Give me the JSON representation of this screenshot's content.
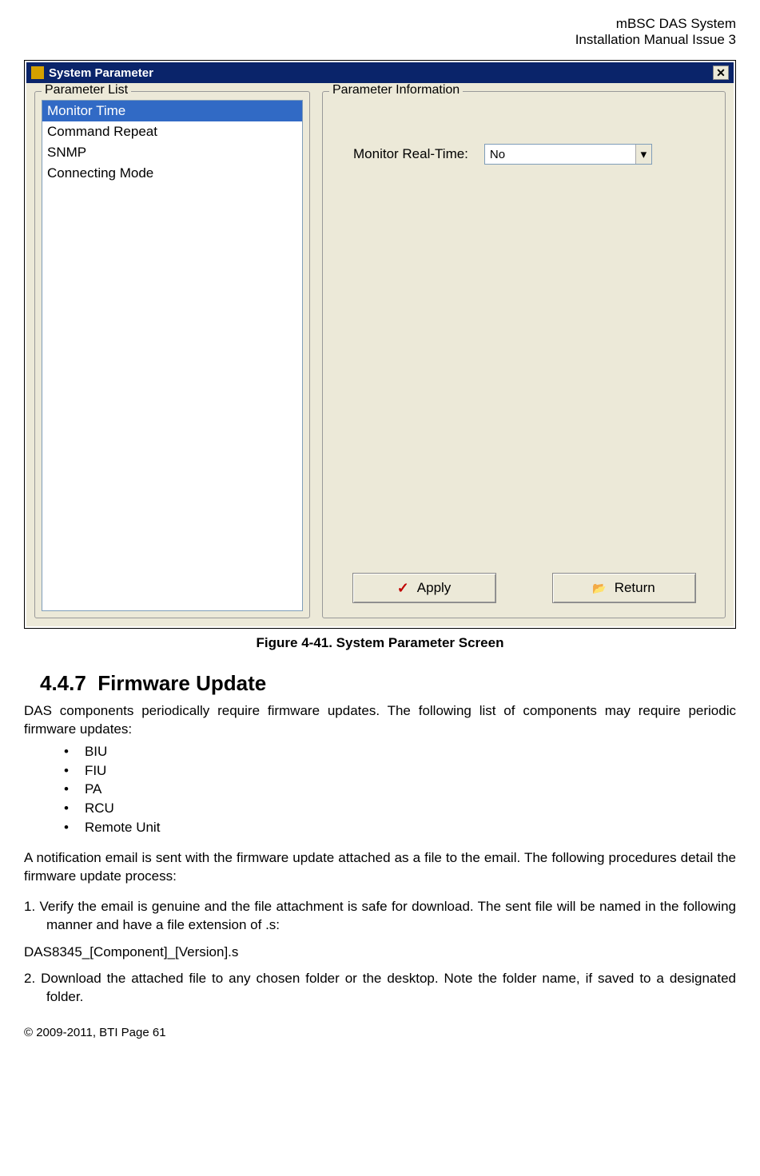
{
  "header": {
    "line1": "mBSC DAS System",
    "line2": "Installation Manual Issue 3"
  },
  "dialog": {
    "title": "System Parameter",
    "param_list_label": "Parameter List",
    "param_info_label": "Parameter Information",
    "params": [
      "Monitor Time",
      "Command Repeat",
      "SNMP",
      "Connecting Mode"
    ],
    "info_label": "Monitor Real-Time:",
    "info_value": "No",
    "apply_label": "Apply",
    "return_label": "Return"
  },
  "figure_caption": "Figure 4-41. System Parameter Screen",
  "section": {
    "number": "4.4.7",
    "title": "Firmware Update"
  },
  "paragraphs": {
    "intro": "DAS components periodically require firmware updates. The following list of components may require periodic firmware updates:",
    "bullets": [
      "BIU",
      "FIU",
      "PA",
      "RCU",
      "Remote Unit"
    ],
    "notification": "A notification email is sent with the firmware update attached as a file to the email. The following procedures detail the firmware update process:",
    "step1": "1.  Verify the email is genuine and the file attachment is safe for download. The sent file will be named in the following manner and have a file extension of .s:",
    "filename": "DAS8345_[Component]_[Version].s",
    "step2": "2.  Download the attached file to any chosen folder or the desktop. Note the folder name, if saved to a designated folder."
  },
  "footer": "© 2009-2011, BTI Page 61"
}
